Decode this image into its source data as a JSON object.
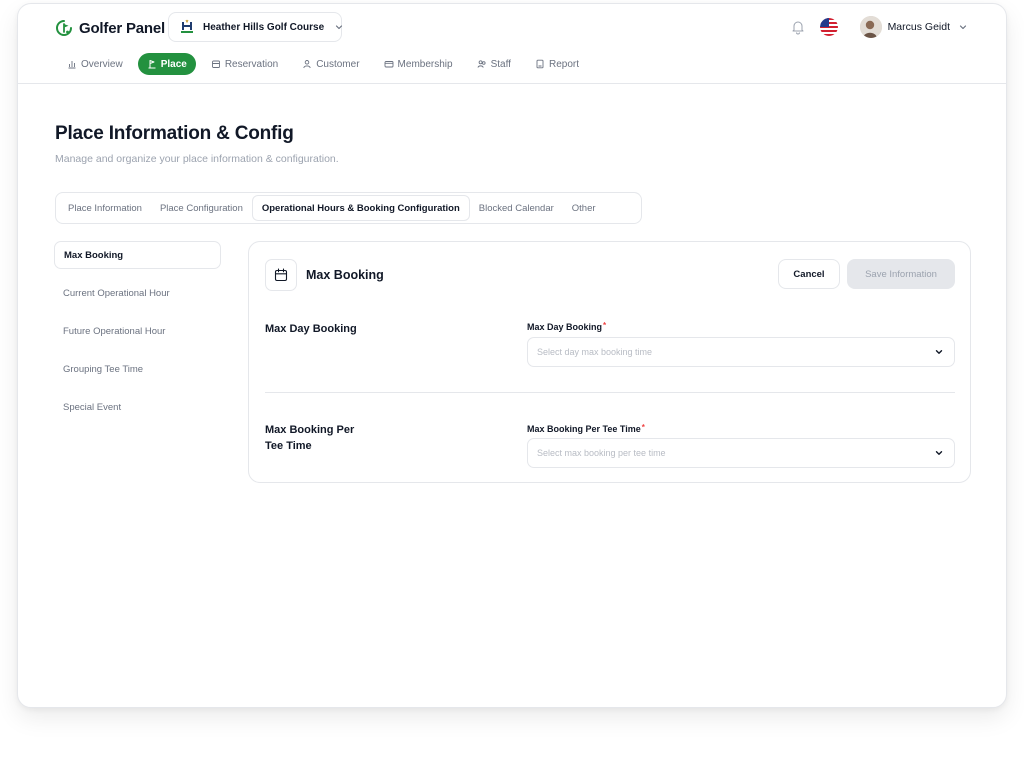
{
  "brand": {
    "name": "Golfer Panel",
    "icon": "golf-flag-logo-icon"
  },
  "course_select": {
    "name": "Heather Hills Golf Course",
    "icon": "course-crest-icon"
  },
  "header": {
    "user_name": "Marcus Geidt",
    "icons": [
      "bell-icon",
      "us-flag-icon",
      "avatar",
      "chevron-down-icon"
    ]
  },
  "nav": {
    "items": [
      {
        "label": "Overview",
        "icon": "chart-icon",
        "active": false
      },
      {
        "label": "Place",
        "icon": "place-icon",
        "active": true
      },
      {
        "label": "Reservation",
        "icon": "reservation-icon",
        "active": false
      },
      {
        "label": "Customer",
        "icon": "user-icon",
        "active": false
      },
      {
        "label": "Membership",
        "icon": "card-icon",
        "active": false
      },
      {
        "label": "Staff",
        "icon": "staff-icon",
        "active": false
      },
      {
        "label": "Report",
        "icon": "report-icon",
        "active": false
      }
    ]
  },
  "page": {
    "title": "Place Information & Config",
    "subtitle": "Manage and organize your place information & configuration."
  },
  "tabs": [
    {
      "label": "Place Information",
      "active": false
    },
    {
      "label": "Place Configuration",
      "active": false
    },
    {
      "label": "Operational Hours & Booking Configuration",
      "active": true
    },
    {
      "label": "Blocked Calendar",
      "active": false
    },
    {
      "label": "Other",
      "active": false
    }
  ],
  "side_menu": [
    {
      "label": "Max Booking",
      "active": true
    },
    {
      "label": "Current Operational Hour",
      "active": false
    },
    {
      "label": "Future Operational Hour",
      "active": false
    },
    {
      "label": "Grouping Tee Time",
      "active": false
    },
    {
      "label": "Special Event",
      "active": false
    }
  ],
  "card": {
    "title": "Max Booking",
    "icon": "calendar-icon",
    "cancel_label": "Cancel",
    "save_label": "Save Information",
    "sections": [
      {
        "row_label": "Max Day Booking",
        "field_label": "Max Day Booking",
        "required_mark": "*",
        "placeholder": "Select day max booking time",
        "value": ""
      },
      {
        "row_label": "Max Booking Per Tee Time",
        "field_label": "Max Booking Per Tee Time",
        "required_mark": "*",
        "placeholder": "Select max booking per tee time",
        "value": ""
      }
    ]
  },
  "colors": {
    "accent": "#23913f",
    "border": "#e5e7eb",
    "muted_text": "#6b7280",
    "placeholder": "#b8bcc4",
    "required": "#ef4444",
    "disabled_bg": "#e5e7eb"
  }
}
